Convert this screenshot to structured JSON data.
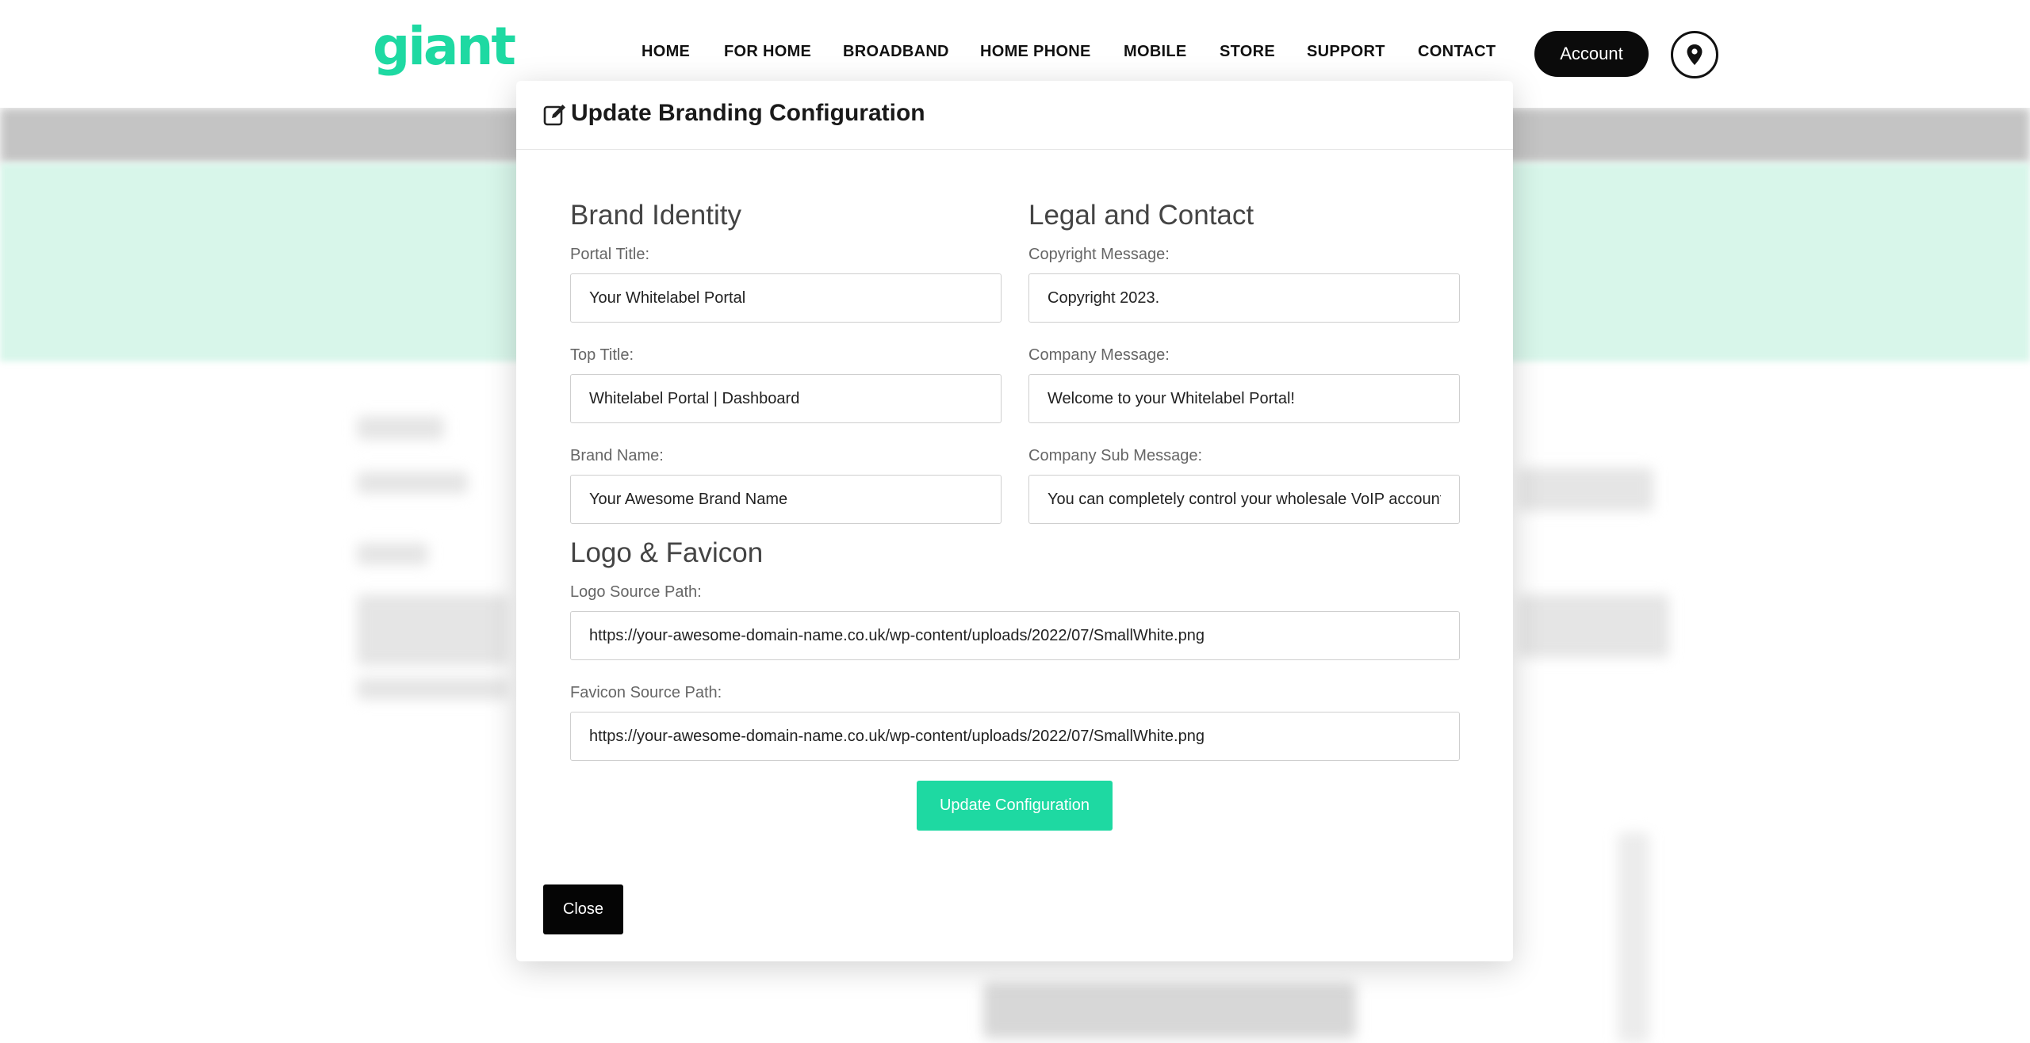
{
  "header": {
    "logo_text": "giant",
    "nav": [
      "HOME",
      "FOR HOME",
      "BROADBAND",
      "HOME PHONE",
      "MOBILE",
      "STORE",
      "SUPPORT",
      "CONTACT"
    ],
    "account_label": "Account",
    "location_icon": "map-pin-icon",
    "brand_color": "#1ed9a2"
  },
  "modal": {
    "title": "Update Branding Configuration",
    "title_icon": "edit-icon",
    "brand_identity": {
      "heading": "Brand Identity",
      "portal_title_label": "Portal Title:",
      "portal_title_value": "Your Whitelabel Portal",
      "top_title_label": "Top Title:",
      "top_title_value": "Whitelabel Portal | Dashboard",
      "brand_name_label": "Brand Name:",
      "brand_name_value": "Your Awesome Brand Name"
    },
    "legal_contact": {
      "heading": "Legal and Contact",
      "copyright_label": "Copyright Message:",
      "copyright_value": "Copyright 2023.",
      "company_message_label": "Company Message:",
      "company_message_value": "Welcome to your Whitelabel Portal!",
      "company_sub_label": "Company Sub Message:",
      "company_sub_value": "You can completely control your wholesale VoIP account"
    },
    "logo_favicon": {
      "heading": "Logo & Favicon",
      "logo_label": "Logo Source Path:",
      "logo_value": "https://your-awesome-domain-name.co.uk/wp-content/uploads/2022/07/SmallWhite.png",
      "favicon_label": "Favicon Source Path:",
      "favicon_value": "https://your-awesome-domain-name.co.uk/wp-content/uploads/2022/07/SmallWhite.png"
    },
    "update_label": "Update Configuration",
    "close_label": "Close",
    "button_color": "#1ed9a2"
  }
}
